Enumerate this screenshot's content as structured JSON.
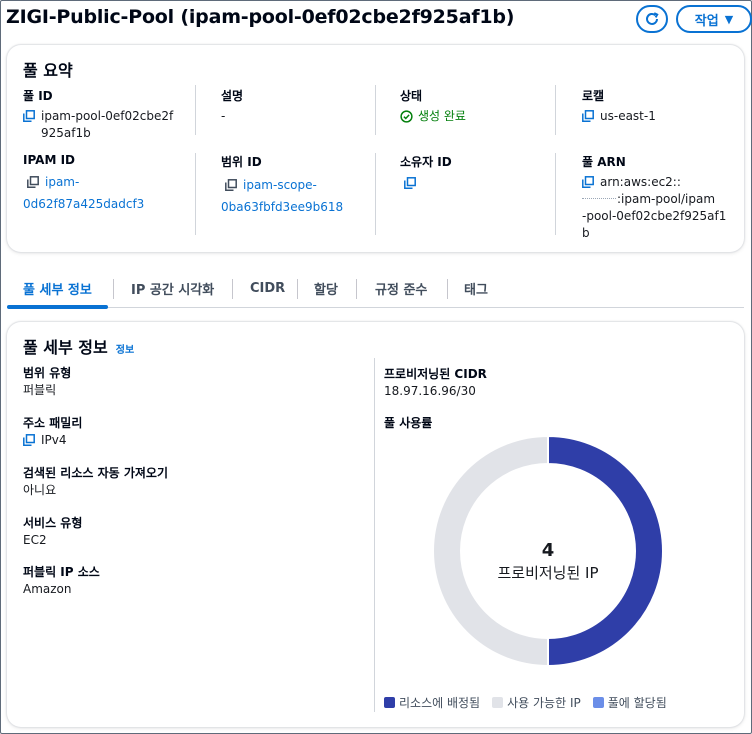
{
  "header": {
    "title": "ZIGI-Public-Pool (ipam-pool-0ef02cbe2f925af1b)",
    "actions_label": "작업"
  },
  "summary": {
    "title": "풀 요약",
    "pool_id_label": "풀 ID",
    "pool_id_line1": "ipam-pool-0ef02cbe2f",
    "pool_id_line2": "925af1b",
    "description_label": "설명",
    "description_value": "-",
    "status_label": "상태",
    "status_value": "생성 완료",
    "locale_label": "로캘",
    "locale_value": "us-east-1",
    "ipam_id_label": "IPAM ID",
    "ipam_id_line1": "ipam-",
    "ipam_id_line2": "0d62f87a425dadcf3",
    "scope_id_label": "범위 ID",
    "scope_id_line1": "ipam-scope-",
    "scope_id_line2": "0ba63fbfd3ee9b618",
    "owner_id_label": "소유자 ID",
    "arn_label": "풀 ARN",
    "arn_line1": "arn:aws:ec2::",
    "arn_line2": ":ipam-pool/ipam",
    "arn_line3": "-pool-0ef02cbe2f925af1",
    "arn_line4": "b"
  },
  "tabs": [
    {
      "label": "풀 세부 정보"
    },
    {
      "label": "IP 공간 시각화"
    },
    {
      "label": "CIDR"
    },
    {
      "label": "할당"
    },
    {
      "label": "규정 준수"
    },
    {
      "label": "태그"
    }
  ],
  "details": {
    "title": "풀 세부 정보",
    "info_label": "정보",
    "scope_type_label": "범위 유형",
    "scope_type_value": "퍼블릭",
    "address_family_label": "주소 패밀리",
    "address_family_value": "IPv4",
    "auto_import_label": "검색된 리소스 자동 가져오기",
    "auto_import_value": "아니요",
    "service_type_label": "서비스 유형",
    "service_type_value": "EC2",
    "public_ip_source_label": "퍼블릭 IP 소스",
    "public_ip_source_value": "Amazon",
    "provisioned_cidr_label": "프로비저닝된 CIDR",
    "provisioned_cidr_value": "18.97.16.96/30",
    "usage_label": "풀 사용률"
  },
  "chart_data": {
    "type": "pie",
    "donut": true,
    "center_value": "4",
    "center_label": "프로비저닝된 IP",
    "series": [
      {
        "name": "리소스에 배정됨",
        "value": 2,
        "color": "#2f3ea8"
      },
      {
        "name": "사용 가능한 IP",
        "value": 2,
        "color": "#e1e3e8"
      },
      {
        "name": "풀에 할당됨",
        "value": 0,
        "color": "#6b8ee8"
      }
    ]
  },
  "colors": {
    "accent": "#0972d3",
    "success": "#037f0c"
  }
}
